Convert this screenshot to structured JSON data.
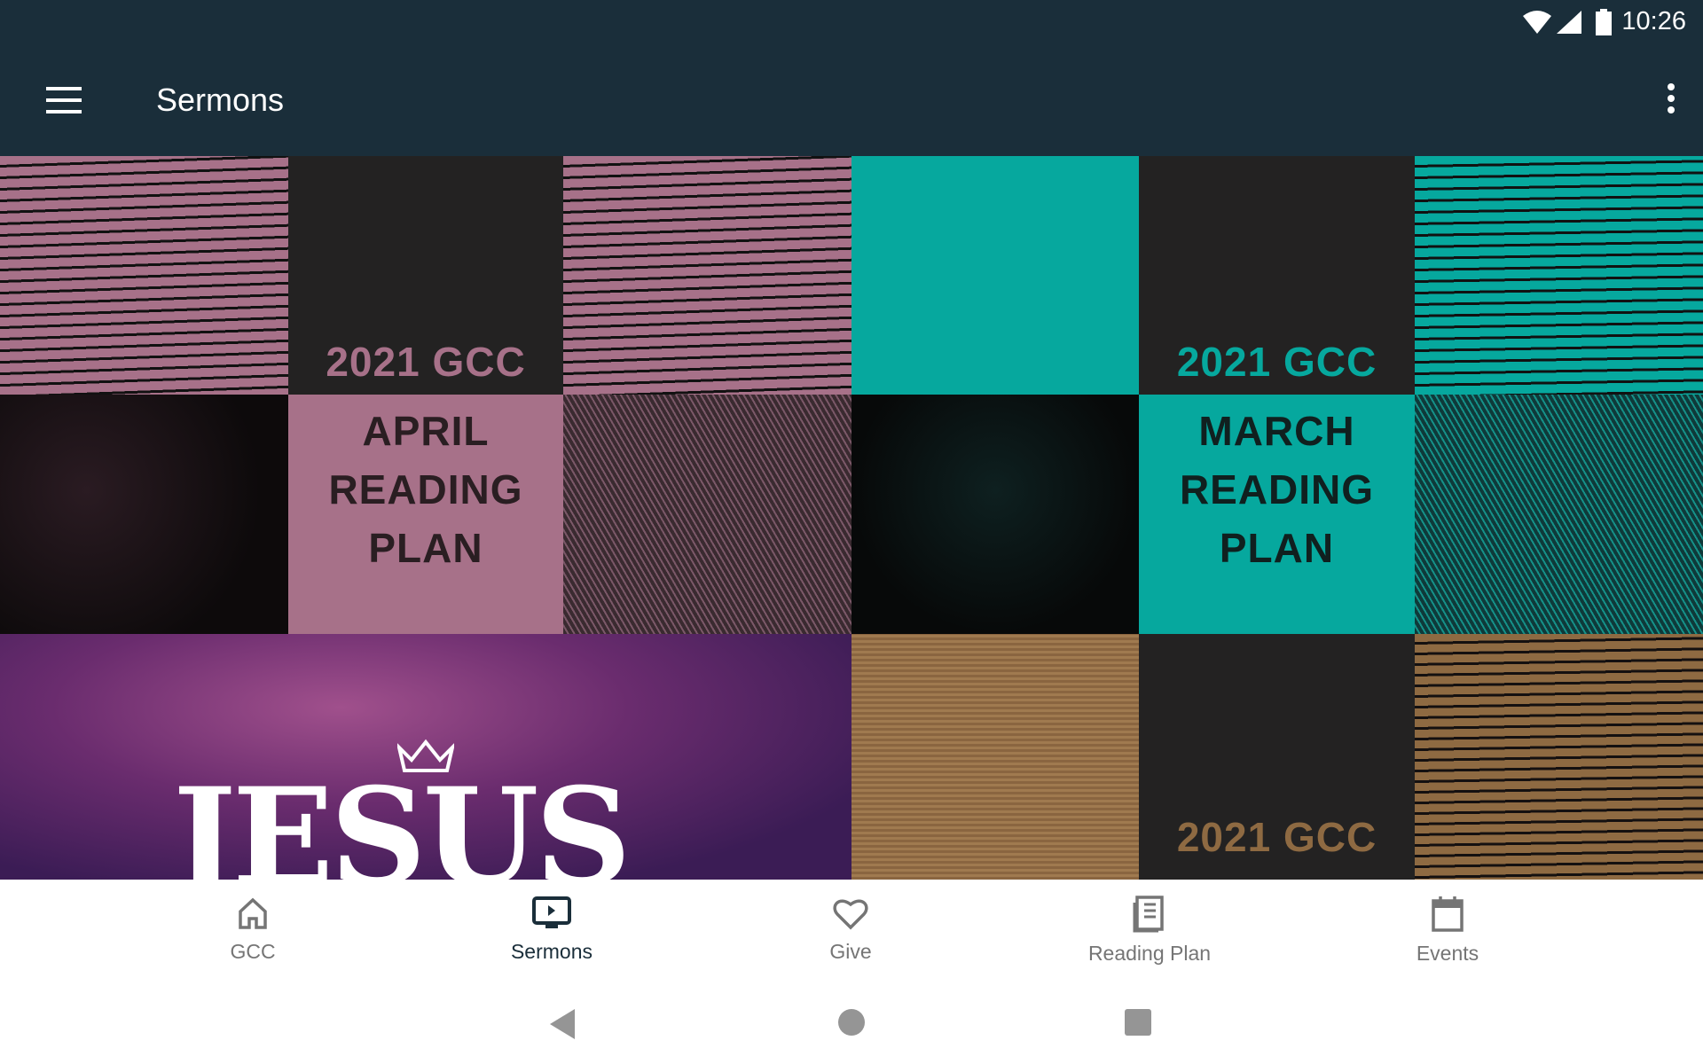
{
  "status_bar": {
    "time": "10:26",
    "icons": [
      "wifi-icon",
      "signal-icon",
      "battery-icon"
    ]
  },
  "app_bar": {
    "title": "Sermons",
    "menu_icon": "hamburger-icon",
    "overflow_icon": "more-vert-icon"
  },
  "sermons": [
    {
      "year_label": "2021 GCC",
      "title_lines": [
        "APRIL",
        "READING",
        "PLAN"
      ],
      "accent": "#a77189"
    },
    {
      "year_label": "2021 GCC",
      "title_lines": [
        "MARCH",
        "READING",
        "PLAN"
      ],
      "accent": "#06a89e"
    },
    {
      "title": "JESUS",
      "accent": "#6a2c6e"
    },
    {
      "year_label": "2021 GCC",
      "accent": "#8e6a42"
    }
  ],
  "bottom_nav": {
    "items": [
      {
        "label": "GCC",
        "icon": "home-icon"
      },
      {
        "label": "Sermons",
        "icon": "video-icon",
        "active": true
      },
      {
        "label": "Give",
        "icon": "heart-icon"
      },
      {
        "label": "Reading Plan",
        "icon": "book-icon"
      },
      {
        "label": "Events",
        "icon": "calendar-icon"
      }
    ]
  },
  "colors": {
    "app_bar": "#1a2e3a",
    "active_nav": "#1a2e3a",
    "inactive_nav": "#757575"
  }
}
